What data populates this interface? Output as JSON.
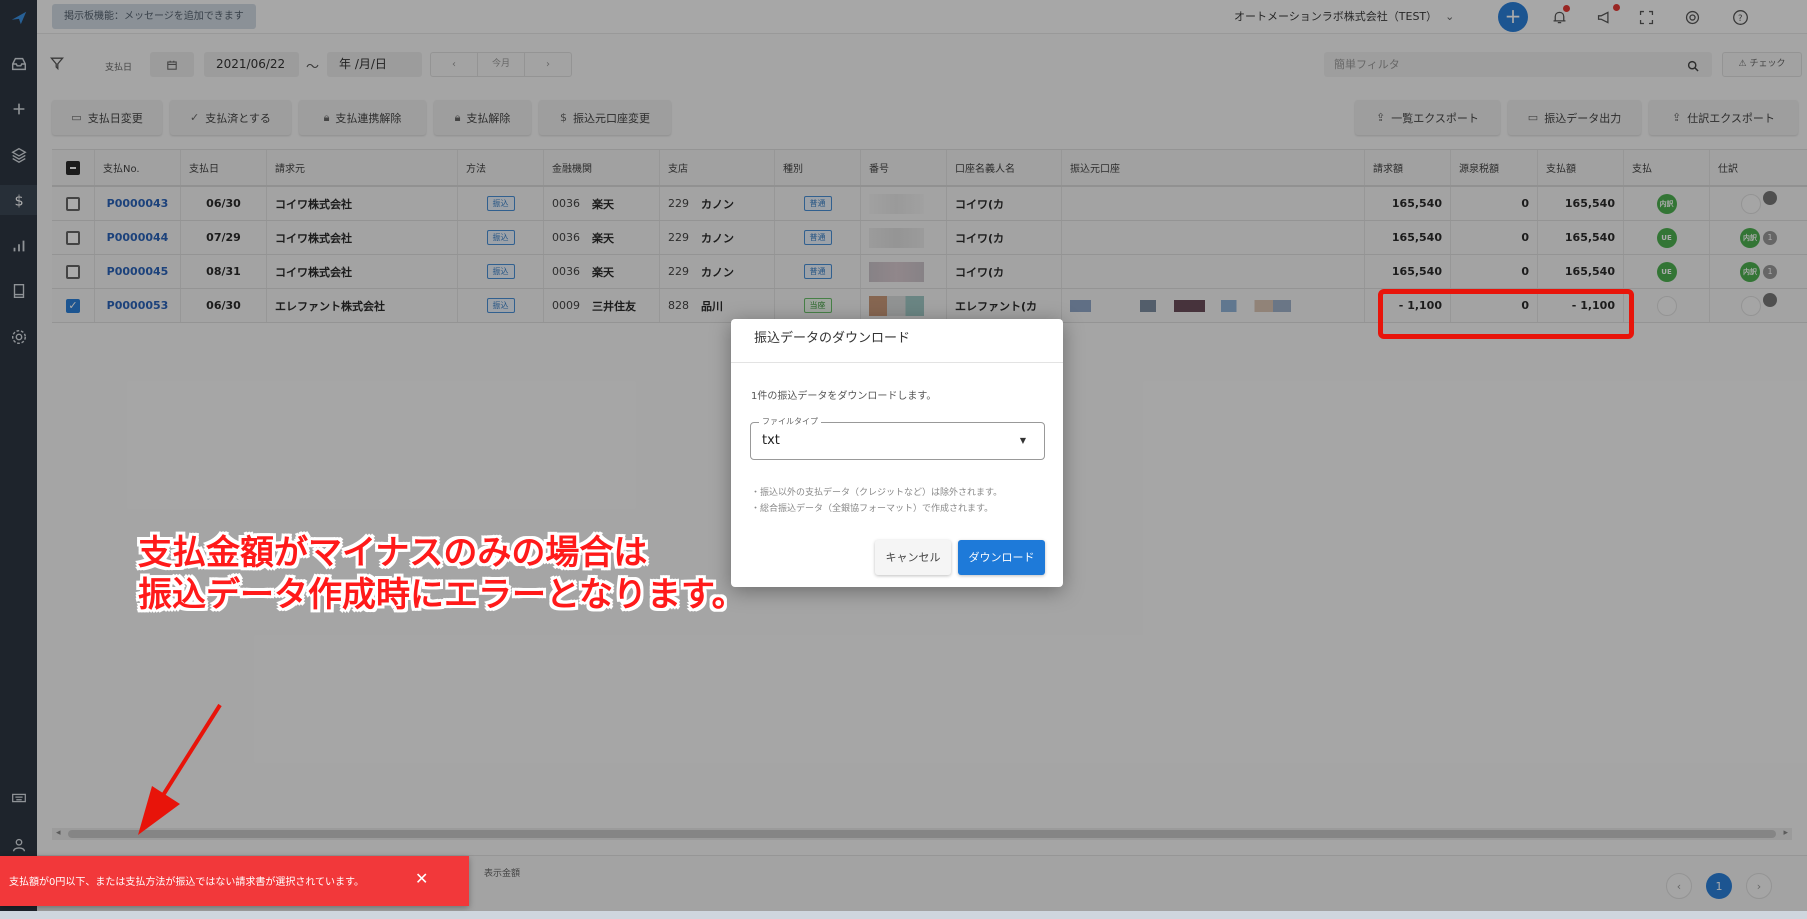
{
  "topbar": {
    "board_chip": "掲示板機能：メッセージを追加できます",
    "company": "オートメーションラボ株式会社（TEST）",
    "company_caret": "⌄",
    "plus": "+"
  },
  "filter": {
    "label": "支払日",
    "date_from": "2021/06/22",
    "tilde": "〜",
    "date_to": "年 /月/日",
    "prev": "‹",
    "today": "今月",
    "next": "›",
    "search_placeholder": "簡単フィルタ",
    "check_label": "⚠ チェック"
  },
  "actions": {
    "change_date": "支払日変更",
    "mark_paid": "支払済とする",
    "unlink": "支払連携解除",
    "cancel_payment": "支払解除",
    "change_account": "振込元口座変更",
    "export_list": "一覧エクスポート",
    "transfer_output": "振込データ出力",
    "journal_export": "仕訳エクスポート"
  },
  "table": {
    "headers": [
      "支払No.",
      "支払日",
      "請求元",
      "方法",
      "金融機関",
      "支店",
      "種別",
      "番号",
      "口座名義人名",
      "振込元口座",
      "請求額",
      "源泉税額",
      "支払額",
      "支払",
      "仕訳"
    ],
    "rows": [
      {
        "no": "P0000043",
        "date": "06/30",
        "vendor": "コイワ株式会社",
        "method": "振込",
        "bank_code": "0036",
        "bank": "楽天",
        "branch_code": "229",
        "branch": "カノン",
        "type": "普通",
        "holder": "コイワ(カ",
        "invoice": "165,540",
        "tax": "0",
        "paid": "165,540",
        "pay_badge": "内訳",
        "checked": false
      },
      {
        "no": "P0000044",
        "date": "07/29",
        "vendor": "コイワ株式会社",
        "method": "振込",
        "bank_code": "0036",
        "bank": "楽天",
        "branch_code": "229",
        "branch": "カノン",
        "type": "普通",
        "holder": "コイワ(カ",
        "invoice": "165,540",
        "tax": "0",
        "paid": "165,540",
        "pay_badge": "UE",
        "journal_badge": "内訳",
        "journal_count": "1",
        "checked": false
      },
      {
        "no": "P0000045",
        "date": "08/31",
        "vendor": "コイワ株式会社",
        "method": "振込",
        "bank_code": "0036",
        "bank": "楽天",
        "branch_code": "229",
        "branch": "カノン",
        "type": "普通",
        "holder": "コイワ(カ",
        "invoice": "165,540",
        "tax": "0",
        "paid": "165,540",
        "pay_badge": "UE",
        "journal_badge": "内訳",
        "journal_count": "1",
        "checked": false
      },
      {
        "no": "P0000053",
        "date": "06/30",
        "vendor": "エレファント株式会社",
        "method": "振込",
        "bank_code": "0009",
        "bank": "三井住友",
        "branch_code": "828",
        "branch": "品川",
        "type": "当座",
        "holder": "エレファント(カ",
        "invoice": "- 1,100",
        "tax": "0",
        "paid": "- 1,100",
        "checked": true
      }
    ]
  },
  "footer": {
    "label": "表示金額",
    "prev": "‹",
    "page": "1",
    "next": "›"
  },
  "dialog": {
    "title": "振込データのダウンロード",
    "message": "1件の振込データをダウンロードします。",
    "field_label": "ファイルタイプ",
    "field_value": "txt",
    "note1": "・振込以外の支払データ（クレジットなど）は除外されます。",
    "note2": "・総合振込データ（全銀協フォーマット）で作成されます。",
    "cancel": "キャンセル",
    "download": "ダウンロード"
  },
  "annotation": {
    "line1": "支払金額がマイナスのみの場合は",
    "line2": "振込データ作成時にエラーとなります。"
  },
  "toast": {
    "message": "支払額が0円以下、または支払方法が振込ではない請求書が選択されています。",
    "close": "✕"
  },
  "colors": {
    "accent": "#2b7fd8",
    "error": "#f2383a",
    "annotation_red": "#ff1a1a",
    "sidebar": "#2e3742"
  }
}
